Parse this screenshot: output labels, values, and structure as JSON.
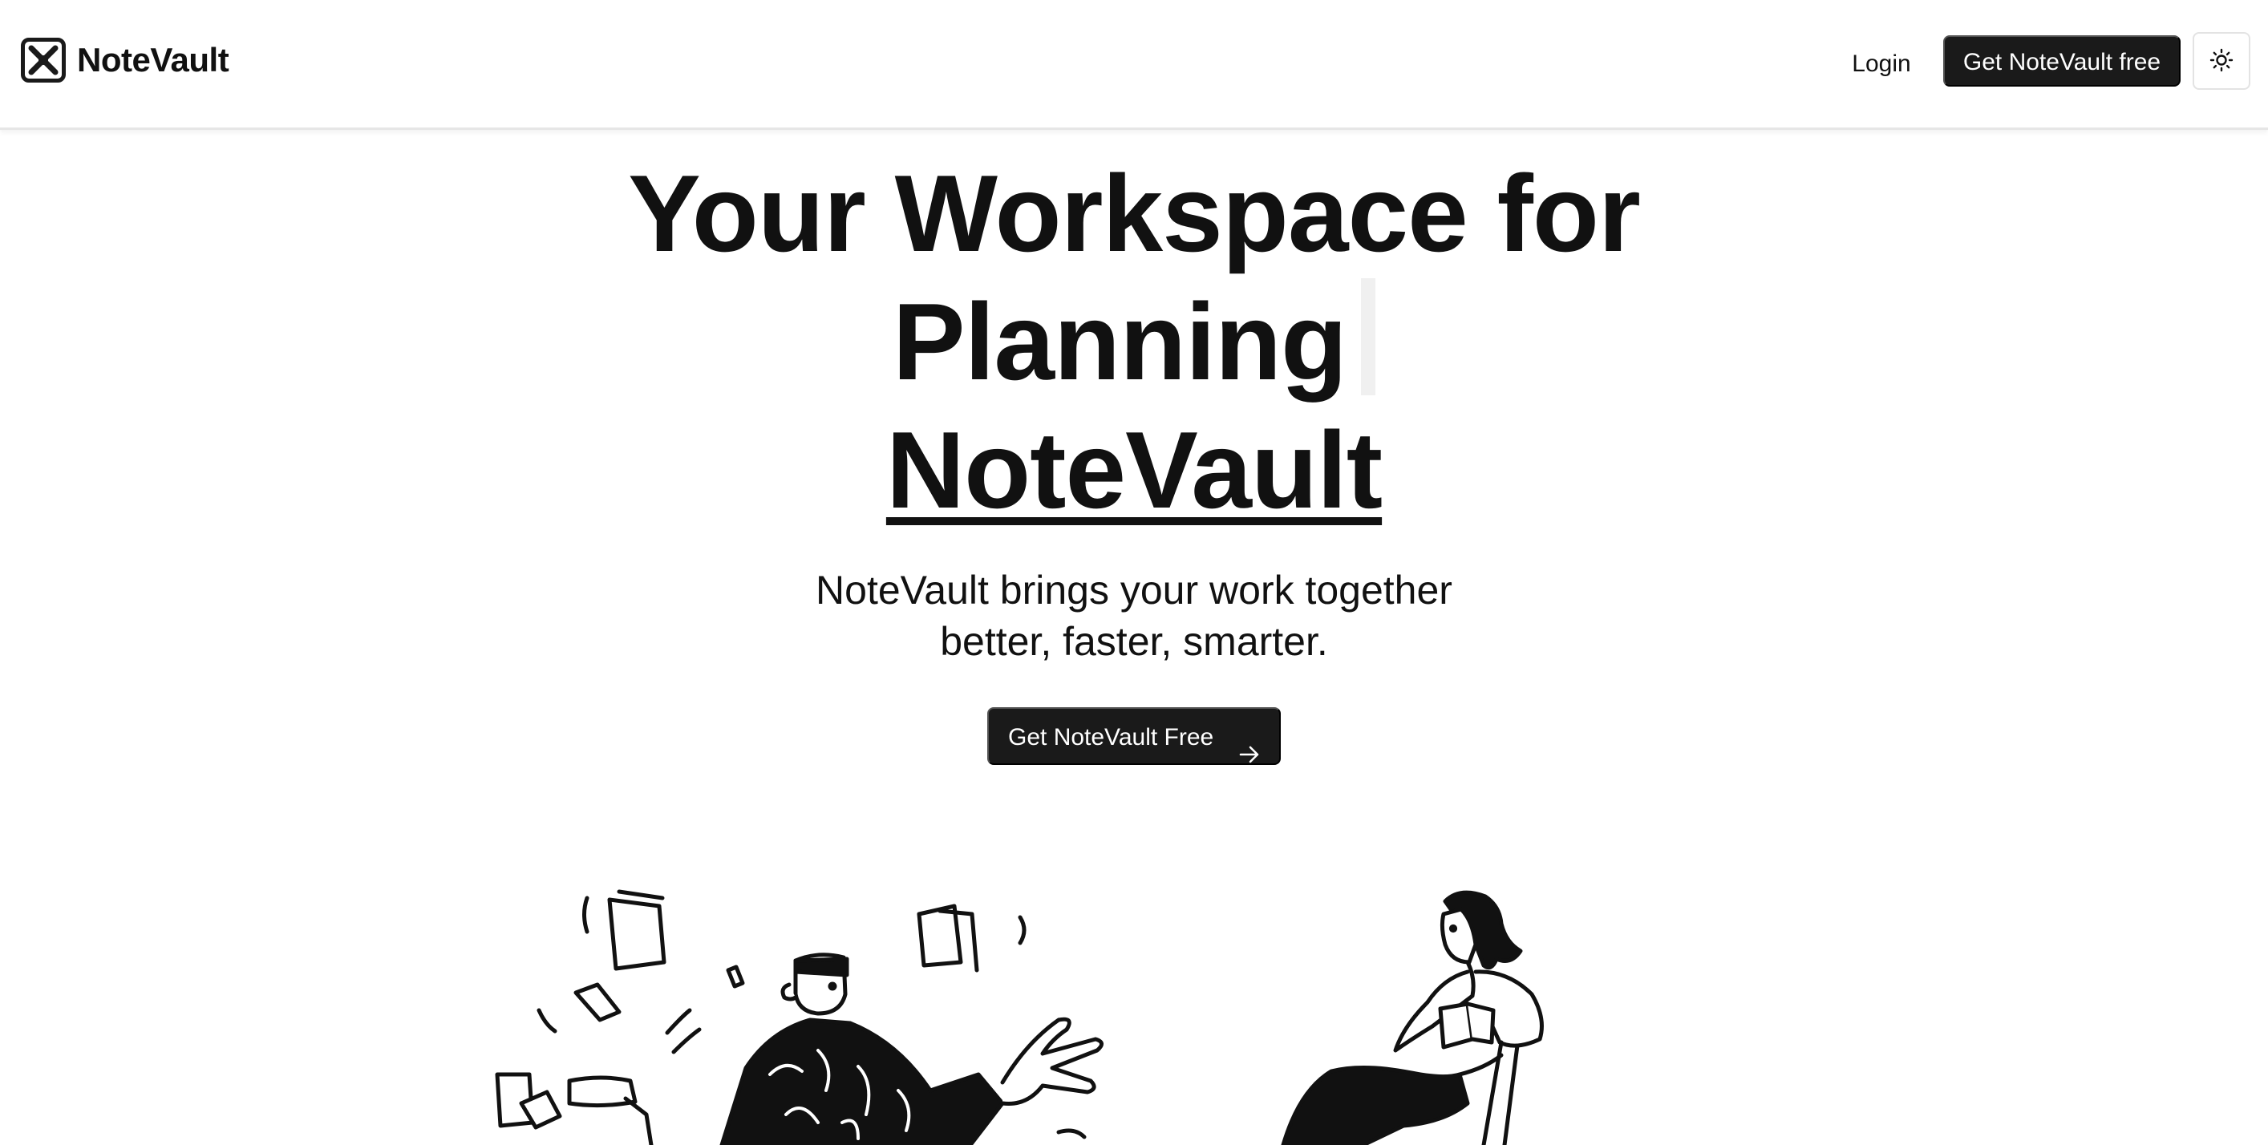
{
  "header": {
    "brand": "NoteVault",
    "login_label": "Login",
    "cta_label": "Get NoteVault free",
    "theme_icon": "sun-icon"
  },
  "hero": {
    "title_line1": "Your Workspace for",
    "title_line2": "Planning",
    "title_line3": "NoteVault",
    "subtitle_line1": "NoteVault brings your work together",
    "subtitle_line2": "better, faster, smarter.",
    "cta_label": "Get NoteVault Free",
    "cta_icon": "arrow-right-icon"
  },
  "colors": {
    "primary": "#1a1a1a",
    "background": "#ffffff",
    "text": "#111111"
  }
}
